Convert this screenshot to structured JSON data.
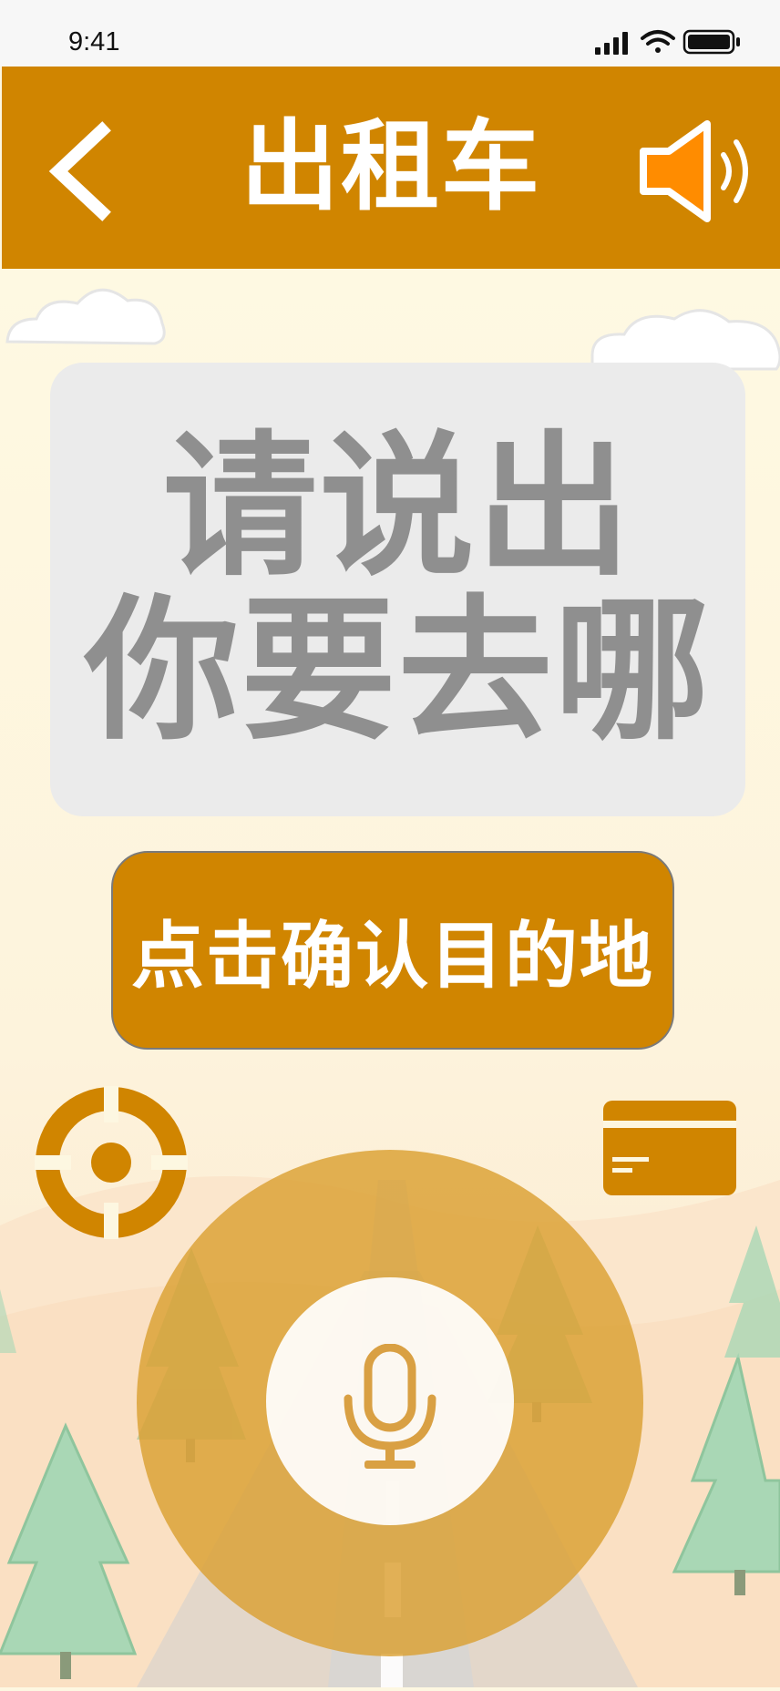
{
  "status_bar": {
    "time": "9:41"
  },
  "header": {
    "title": "出租车",
    "back_icon": "chevron-left-icon",
    "speaker_icon": "speaker-icon"
  },
  "prompt": {
    "line1": "请说出",
    "line2": "你要去哪"
  },
  "confirm_button": {
    "label": "点击确认目的地"
  },
  "controls": {
    "locate_icon": "crosshair-icon",
    "card_icon": "credit-card-icon",
    "mic_icon": "microphone-icon"
  },
  "colors": {
    "accent": "#d08500",
    "speaker_fill": "#ff8c00",
    "prompt_text": "#8f8f8f",
    "card_bg": "#ebebeb",
    "background": "#fdf7e1"
  }
}
